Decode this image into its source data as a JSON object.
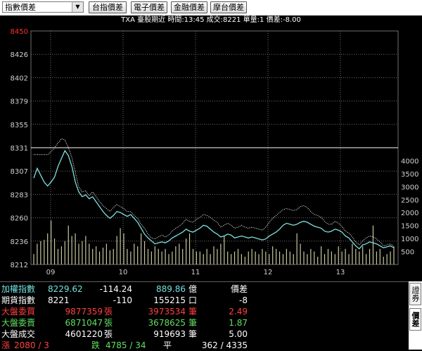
{
  "toolbar": {
    "dropdown_value": "指數價差",
    "buttons": [
      "台指價差",
      "電子價差",
      "金融價差",
      "摩台價差"
    ]
  },
  "infobar": {
    "text": "TXA  臺股期近 時間:13:45 成交:8221 單量:1  價差:-8.00"
  },
  "chart": {
    "price_ticks": [
      "8450",
      "8426",
      "8402",
      "8379",
      "8355",
      "8331",
      "8307",
      "8283",
      "8260",
      "8236",
      "8212"
    ],
    "volume_ticks": [
      "4000",
      "3500",
      "3000",
      "2500",
      "2000",
      "1500",
      "1000",
      "500"
    ],
    "time_ticks": [
      "09",
      "10",
      "11",
      "12",
      "13"
    ],
    "colors": {
      "index_line": "#7fe0e0",
      "futures_line": "#ffffff",
      "volume": "#c8c8a0",
      "grid": "#6e6e6e",
      "axis_text": "#d0d0d0",
      "top_tick": "#ff3030"
    }
  },
  "chart_data": {
    "type": "line",
    "title": "",
    "ylim": [
      8212,
      8450
    ],
    "y2lim": [
      0,
      4500
    ],
    "x_categories": [
      "09",
      "10",
      "11",
      "12",
      "13"
    ],
    "series": [
      {
        "values": [
          8300,
          8310,
          8303,
          8296,
          8292,
          8296,
          8301,
          8312,
          8320,
          8328,
          8323,
          8312,
          8296,
          8286,
          8281,
          8283,
          8279,
          8281,
          8276,
          8271,
          8266,
          8262,
          8259,
          8262,
          8266,
          8265,
          8263,
          8261,
          8263,
          8259,
          8255,
          8249,
          8243,
          8239,
          8236,
          8233,
          8234,
          8235,
          8234,
          8236,
          8239,
          8241,
          8243,
          8245,
          8248,
          8246,
          8245,
          8247,
          8249,
          8252,
          8251,
          8248,
          8245,
          8243,
          8240,
          8241,
          8243,
          8242,
          8239,
          8240,
          8241,
          8240,
          8239,
          8240,
          8239,
          8238,
          8237,
          8238,
          8241,
          8243,
          8245,
          8248,
          8252,
          8254,
          8253,
          8252,
          8253,
          8255,
          8256,
          8255,
          8253,
          8251,
          8250,
          8249,
          8246,
          8245,
          8246,
          8248,
          8247,
          8245,
          8241,
          8239,
          8235,
          8231,
          8228,
          8232,
          8233,
          8235,
          8234,
          8233,
          8231,
          8229,
          8230,
          8231,
          8229
        ]
      },
      {
        "values": [
          8324,
          8324,
          8324,
          8324,
          8324,
          8327,
          8331,
          8336,
          8340,
          8339,
          8331,
          8321,
          8306,
          8291,
          8286,
          8287,
          8282,
          8286,
          8281,
          8276,
          8272,
          8269,
          8266,
          8270,
          8273,
          8271,
          8269,
          8266,
          8266,
          8262,
          8259,
          8253,
          8249,
          8243,
          8239,
          8238,
          8240,
          8242,
          8240,
          8242,
          8246,
          8249,
          8251,
          8254,
          8258,
          8256,
          8255,
          8258,
          8260,
          8263,
          8262,
          8260,
          8257,
          8255,
          8250,
          8252,
          8254,
          8252,
          8249,
          8250,
          8252,
          8250,
          8249,
          8250,
          8249,
          8248,
          8247,
          8250,
          8255,
          8259,
          8262,
          8265,
          8268,
          8269,
          8268,
          8267,
          8268,
          8271,
          8272,
          8270,
          8266,
          8263,
          8262,
          8260,
          8256,
          8253,
          8253,
          8256,
          8254,
          8251,
          8246,
          8244,
          8240,
          8235,
          8232,
          8236,
          8239,
          8241,
          8240,
          8238,
          8235,
          8231,
          8232,
          8233,
          8231
        ]
      },
      {
        "values": [
          400,
          800,
          900,
          950,
          1200,
          1700,
          1000,
          600,
          700,
          900,
          1500,
          1100,
          1200,
          800,
          900,
          1100,
          800,
          600,
          700,
          500,
          650,
          800,
          550,
          600,
          1100,
          1400,
          1200,
          600,
          500,
          800,
          700,
          1200,
          900,
          600,
          500,
          700,
          600,
          500,
          600,
          400,
          500,
          700,
          800,
          600,
          1000,
          1200,
          600,
          500,
          500,
          400,
          600,
          400,
          700,
          600,
          800,
          1100,
          500,
          400,
          500,
          600,
          400,
          300,
          500,
          600,
          500,
          400,
          600,
          500,
          400,
          700,
          600,
          500,
          400,
          600,
          500,
          400,
          1200,
          800,
          500,
          400,
          600,
          500,
          300,
          700,
          400,
          600,
          500,
          400,
          700,
          500,
          600,
          400,
          800,
          600,
          500,
          700,
          400,
          600,
          1500,
          500,
          600,
          300,
          400,
          500,
          700
        ]
      }
    ]
  },
  "quote": {
    "rows": [
      {
        "label": "加權指數",
        "v1": "8229.62",
        "v2": "-114.24",
        "v3": "889.86",
        "unit": "億",
        "extra": "價差",
        "c1": "#6fe0e0",
        "c2": "#ffffff",
        "c3": "#6fe0e0",
        "cu": "#ffffff",
        "ce": "#ffffff",
        "cl": "#6fe0e0"
      },
      {
        "label": "期貨指數",
        "v1": "8221",
        "v2": "-110",
        "v3": "155215",
        "unit": "口",
        "extra": "-8",
        "c1": "#ffffff",
        "c2": "#ffffff",
        "c3": "#ffffff",
        "cu": "#ffffff",
        "ce": "#ffffff",
        "cl": "#ffffff"
      },
      {
        "label": "大盤委買",
        "v1": "9877359",
        "v1u": "張",
        "v3": "3973534",
        "unit": "筆",
        "extra": "2.49",
        "c1": "#ff4040",
        "c3": "#ff4040",
        "cu": "#ff4040",
        "ce": "#ff4040",
        "cl": "#ff4040"
      },
      {
        "label": "大盤委賣",
        "v1": "6871047",
        "v1u": "張",
        "v3": "3678625",
        "unit": "筆",
        "extra": "1.87",
        "c1": "#60e060",
        "c3": "#60e060",
        "cu": "#60e060",
        "ce": "#60e060",
        "cl": "#60e060"
      },
      {
        "label": "大盤成交",
        "v1": "4601220",
        "v1u": "張",
        "v3": "919693",
        "unit": "筆",
        "extra": "5.00",
        "c1": "#ffffff",
        "c3": "#ffffff",
        "cu": "#ffffff",
        "ce": "#ffffff",
        "cl": "#ffffff"
      }
    ],
    "breadth": {
      "up_label": "漲",
      "up": "2080 / 3",
      "down_label": "跌",
      "down": "4785 / 34",
      "flat_label": "平",
      "flat": "362 / 4335"
    }
  },
  "sidetabs": [
    "證券",
    "價差"
  ]
}
